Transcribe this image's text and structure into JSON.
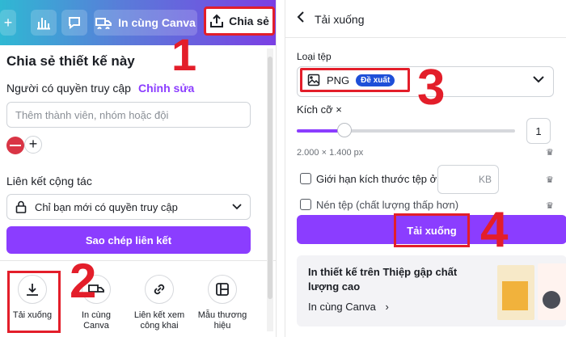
{
  "left_panel": {
    "topbar": {
      "print_canva_label": "In cùng Canva",
      "share_label": "Chia sẻ"
    },
    "title": "Chia sẻ thiết kế này",
    "access_label": "Người có quyền truy cập",
    "access_edit_link": "Chỉnh sửa",
    "member_input_placeholder": "Thêm thành viên, nhóm hoặc đội",
    "collab_label": "Liên kết cộng tác",
    "collab_option": "Chỉ bạn mới có quyền truy cập",
    "copy_link_button": "Sao chép liên kết",
    "options": [
      {
        "label": "Tải xuống",
        "icon": "download-icon"
      },
      {
        "label": "In cùng Canva",
        "icon": "truck-icon"
      },
      {
        "label": "Liên kết xem công khai",
        "icon": "link-icon"
      },
      {
        "label": "Mẫu thương hiệu",
        "icon": "template-icon"
      }
    ]
  },
  "right_panel": {
    "title": "Tải xuống",
    "file_type_label": "Loại tệp",
    "file_type_value": "PNG",
    "file_type_badge": "Đề xuất",
    "size_label": "Kích cỡ ×",
    "size_value": "1",
    "size_slider_fraction": 0.22,
    "dimensions": "2.000 × 1.400 px",
    "limit_size_label": "Giới hạn kích thước tệp ở",
    "kb_unit": "KB",
    "compress_label": "Nén tệp (chất lượng thấp hơn)",
    "download_button": "Tải xuống",
    "promo_title": "In thiết kế trên Thiệp gập chất lượng cao",
    "promo_link": "In cùng Canva"
  },
  "annotations": {
    "step1": "1",
    "step2": "2",
    "step3": "3",
    "step4": "4"
  },
  "colors": {
    "accent": "#8b3dff",
    "highlight": "#e31e2a",
    "badge": "#1e4fd8"
  }
}
